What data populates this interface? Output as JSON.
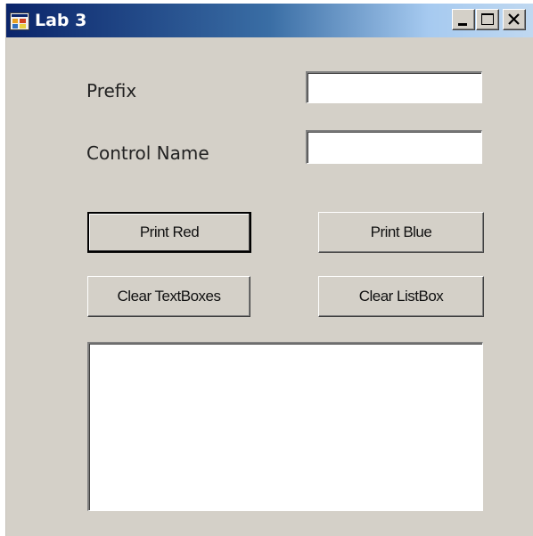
{
  "window": {
    "title": "Lab 3",
    "controls": {
      "minimize": "minimize-icon",
      "maximize": "maximize-icon",
      "close": "close-icon"
    }
  },
  "form": {
    "prefix_label": "Prefix",
    "prefix_value": "",
    "control_name_label": "Control Name",
    "control_name_value": "",
    "print_red_label": "Print Red",
    "print_blue_label": "Print Blue",
    "clear_textboxes_label": "Clear TextBoxes",
    "clear_listbox_label": "Clear ListBox",
    "listbox_items": []
  },
  "colors": {
    "title_gradient_start": "#0a246a",
    "title_gradient_end": "#a6caf0",
    "face": "#d4d0c8"
  }
}
